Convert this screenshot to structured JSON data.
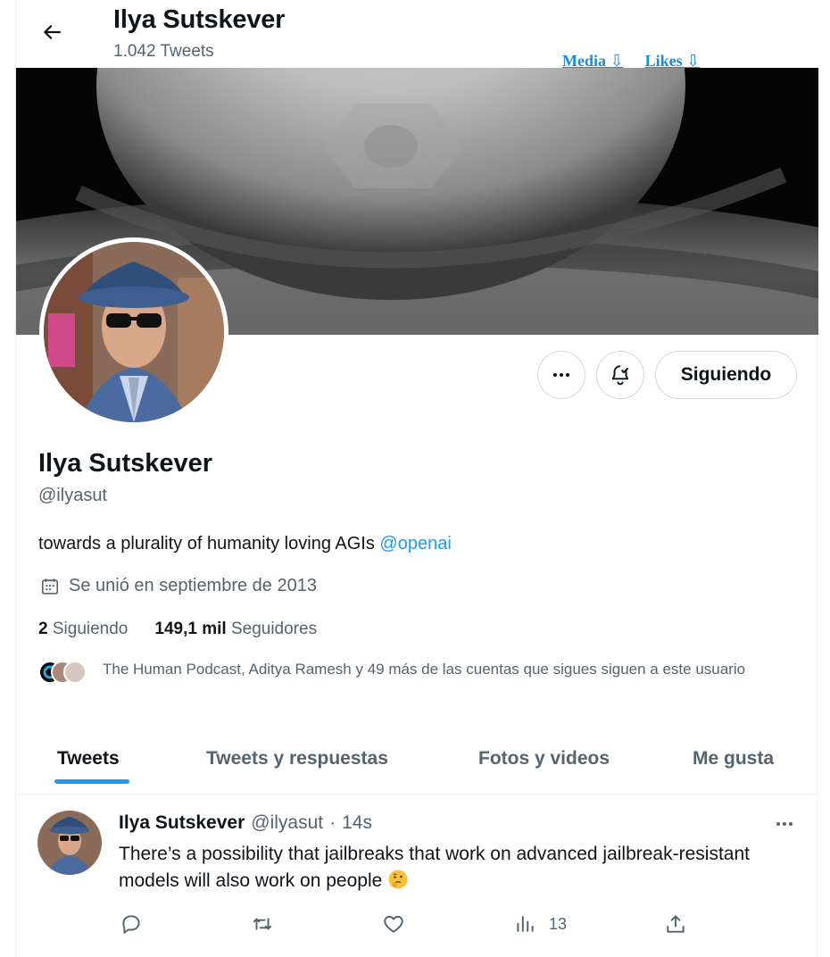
{
  "header": {
    "name": "Ilya Sutskever",
    "tweet_count": "1.042 Tweets",
    "links": [
      "Media ⇩",
      "Likes ⇩"
    ]
  },
  "profile": {
    "name": "Ilya Sutskever",
    "handle": "@ilyasut",
    "bio_text": "towards a plurality of humanity loving AGIs ",
    "bio_mention": "@openai",
    "joined": "Se unió en septiembre de 2013",
    "following_count": "2",
    "following_label": "Siguiendo",
    "followers_count": "149,1 mil",
    "followers_label": "Seguidores",
    "known_followers": "The Human Podcast, Aditya Ramesh y 49 más de las cuentas que sigues siguen a este usuario"
  },
  "actions": {
    "follow_label": "Siguiendo"
  },
  "tabs": [
    {
      "label": "Tweets",
      "active": true
    },
    {
      "label": "Tweets y respuestas",
      "active": false
    },
    {
      "label": "Fotos y videos",
      "active": false
    },
    {
      "label": "Me gusta",
      "active": false
    }
  ],
  "tweet": {
    "name": "Ilya Sutskever",
    "handle": "@ilyasut",
    "separator": "·",
    "time": "14s",
    "text": "There’s a possibility that jailbreaks that work on advanced jailbreak-resistant models will also work on people",
    "views": "13"
  },
  "icons": {
    "back": "arrow-left-icon",
    "more": "more-dots-icon",
    "notify": "bell-check-icon",
    "calendar": "calendar-icon",
    "reply": "reply-icon",
    "retweet": "retweet-icon",
    "like": "heart-icon",
    "views": "views-icon",
    "share": "share-icon"
  },
  "colors": {
    "accent": "#1d9bf0",
    "link": "#1a8cd8",
    "text": "#0f1419",
    "muted": "#536471"
  }
}
